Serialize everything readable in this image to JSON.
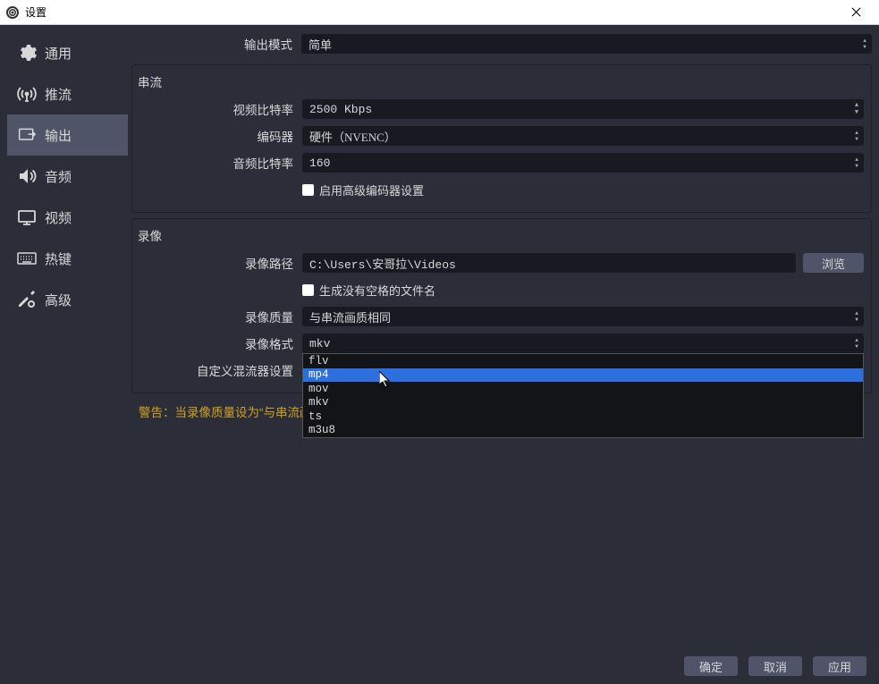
{
  "window": {
    "title": "设置"
  },
  "sidebar": {
    "items": [
      {
        "label": "通用"
      },
      {
        "label": "推流"
      },
      {
        "label": "输出"
      },
      {
        "label": "音频"
      },
      {
        "label": "视频"
      },
      {
        "label": "热键"
      },
      {
        "label": "高级"
      }
    ],
    "active_index": 2
  },
  "output_mode": {
    "label": "输出模式",
    "value": "简单"
  },
  "streaming": {
    "legend": "串流",
    "video_bitrate": {
      "label": "视频比特率",
      "value": "2500 Kbps"
    },
    "encoder": {
      "label": "编码器",
      "value": "硬件（NVENC）"
    },
    "audio_bitrate": {
      "label": "音频比特率",
      "value": "160"
    },
    "advanced": {
      "label": "启用高级编码器设置",
      "checked": false
    }
  },
  "recording": {
    "legend": "录像",
    "path": {
      "label": "录像路径",
      "value": "C:\\Users\\安哥拉\\Videos",
      "browse": "浏览"
    },
    "no_space": {
      "label": "生成没有空格的文件名",
      "checked": false
    },
    "quality": {
      "label": "录像质量",
      "value": "与串流画质相同"
    },
    "format": {
      "label": "录像格式",
      "value": "mkv"
    },
    "muxer": {
      "label": "自定义混流器设置"
    },
    "format_options": [
      "flv",
      "mp4",
      "mov",
      "mkv",
      "ts",
      "m3u8"
    ],
    "format_highlight_index": 1
  },
  "warning": "警告：当录像质量设为“与串流画质相同”时，无法暂停录制。",
  "footer": {
    "ok": "确定",
    "cancel": "取消",
    "apply": "应用"
  }
}
